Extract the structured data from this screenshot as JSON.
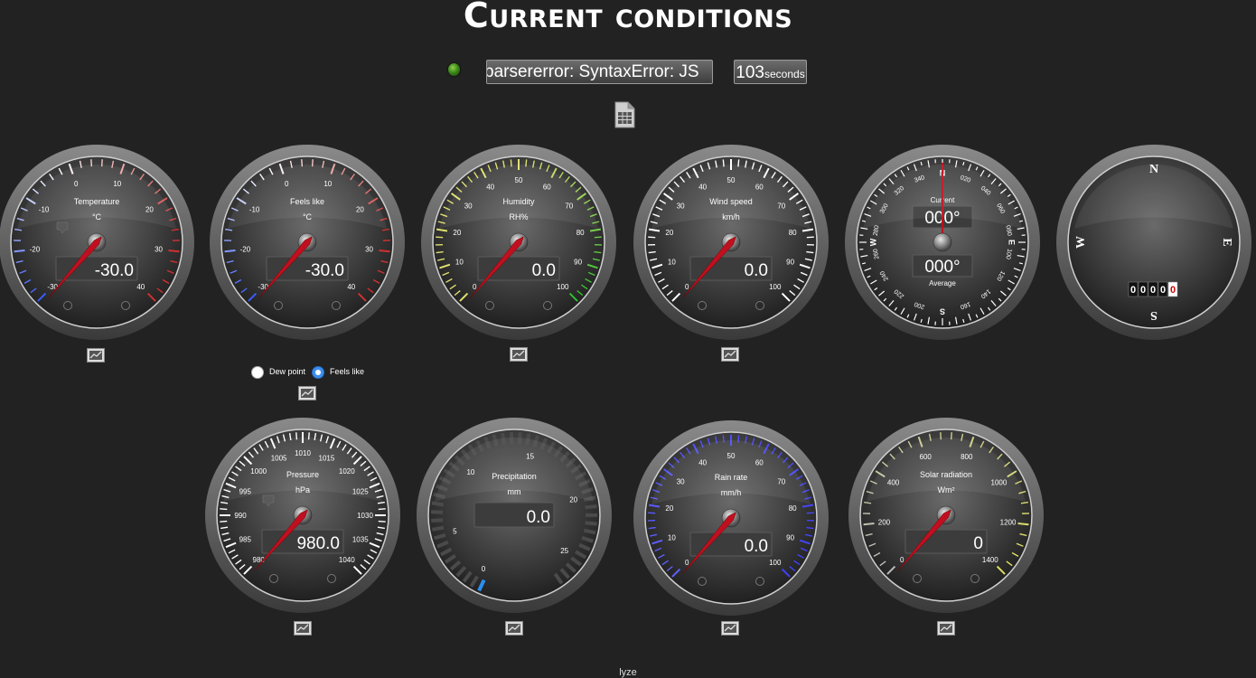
{
  "page": {
    "title": "Current conditions",
    "footer": "lyze"
  },
  "status": {
    "message": "parsererror: SyntaxError: JS",
    "timer_value": "103",
    "timer_unit": "seconds"
  },
  "gauges": {
    "temperature": {
      "title": "Temperature",
      "unit": "°C",
      "value": "-30.0",
      "ticks": [
        "-30",
        "-20",
        "-10",
        "0",
        "10",
        "20",
        "30",
        "40"
      ]
    },
    "feelslike": {
      "title": "Feels like",
      "unit": "°C",
      "value": "-30.0",
      "ticks": [
        "-30",
        "-20",
        "-10",
        "0",
        "10",
        "20",
        "30",
        "40"
      ]
    },
    "humidity": {
      "title": "Humidity",
      "unit": "RH%",
      "value": "0.0",
      "ticks": [
        "0",
        "10",
        "20",
        "30",
        "40",
        "50",
        "60",
        "70",
        "80",
        "90",
        "100"
      ]
    },
    "windspeed": {
      "title": "Wind speed",
      "unit": "km/h",
      "value": "0.0",
      "ticks": [
        "0",
        "10",
        "20",
        "30",
        "40",
        "50",
        "60",
        "70",
        "80",
        "90",
        "100"
      ]
    },
    "winddir": {
      "current_label": "Current",
      "current_value": "000°",
      "average_label": "Average",
      "average_value": "000°",
      "cardinals": [
        "N",
        "E",
        "S",
        "W"
      ],
      "degrees": [
        "020",
        "040",
        "060",
        "080",
        "100",
        "120",
        "140",
        "160",
        "200",
        "220",
        "240",
        "260",
        "280",
        "300",
        "320",
        "340"
      ]
    },
    "compass": {
      "cardinals": [
        "N",
        "E",
        "S",
        "W"
      ],
      "odometer": [
        "0",
        "0",
        "0",
        "0",
        "0"
      ]
    },
    "pressure": {
      "title": "Pressure",
      "unit": "hPa",
      "value": "980.0",
      "ticks": [
        "980",
        "985",
        "990",
        "995",
        "1000",
        "1005",
        "1010",
        "1015",
        "1020",
        "1025",
        "1030",
        "1035",
        "1040"
      ]
    },
    "precipitation": {
      "title": "Precipitation",
      "unit": "mm",
      "value": "0.0",
      "ticks": [
        "0",
        "5",
        "10",
        "15",
        "20",
        "25"
      ]
    },
    "rainrate": {
      "title": "Rain rate",
      "unit": "mm/h",
      "value": "0.0",
      "ticks": [
        "0",
        "10",
        "20",
        "30",
        "40",
        "50",
        "60",
        "70",
        "80",
        "90",
        "100"
      ]
    },
    "solar": {
      "title": "Solar radiation",
      "unit": "Wm²",
      "value": "0",
      "ticks": [
        "0",
        "200",
        "400",
        "600",
        "800",
        "1000",
        "1200",
        "1400"
      ]
    }
  },
  "options": {
    "dewpoint_label": "Dew point",
    "feelslike_label": "Feels like",
    "selected": "Feels like"
  },
  "icons": {
    "report": "spreadsheet-icon",
    "graph": "line-graph-icon",
    "trend": "trend-arrow-icon",
    "led": "status-led-icon"
  },
  "colors": {
    "background": "#222222",
    "cold": "#3a5cff",
    "hot": "#d03030",
    "humidity_low": "#e0e070",
    "humidity_high": "#30c030",
    "rain": "#4040ff",
    "solar": "#e0e060",
    "needle": "#c01020",
    "led": "#3c8a1a"
  }
}
